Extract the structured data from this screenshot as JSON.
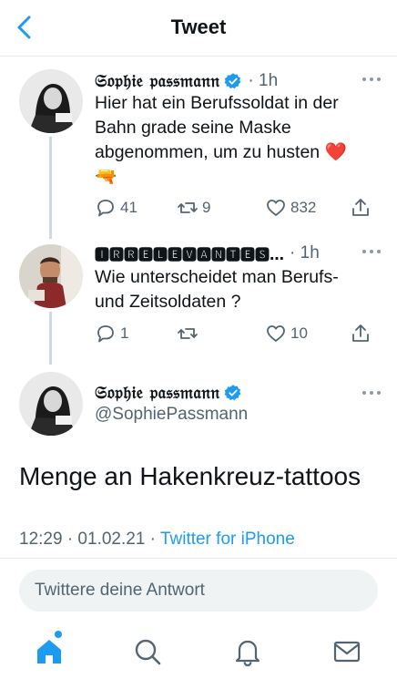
{
  "header": {
    "title": "Tweet"
  },
  "thread": [
    {
      "display_name": "𝔖𝔬𝔭𝔥𝔦𝔢 𝔭𝔞𝔰𝔰𝔪𝔞𝔫𝔫",
      "verified": true,
      "time": "· 1h",
      "text": "Hier hat ein Berufssoldat in der Bahn grade seine Maske abgenommen, um zu husten ❤️",
      "emoji_line": "🔫",
      "replies": "41",
      "retweets": "9",
      "likes": "832"
    },
    {
      "display_name": "🅸🆁🆁🅴🅻🅴🆅🅰🅽🆃🅴🆂…",
      "verified": false,
      "time": "· 1h",
      "text": "Wie unterscheidet man Berufs- und Zeitsoldaten ?",
      "replies": "1",
      "retweets": "",
      "likes": "10"
    }
  ],
  "main_tweet": {
    "display_name": "𝔖𝔬𝔭𝔥𝔦𝔢 𝔭𝔞𝔰𝔰𝔪𝔞𝔫𝔫",
    "verified": true,
    "handle": "@SophiePassmann",
    "text": "Menge an Hakenkreuz-tattoos",
    "timestamp": "12:29 · 01.02.21 · ",
    "source": "Twitter for iPhone"
  },
  "reply": {
    "placeholder": "Twittere deine Antwort"
  },
  "colors": {
    "accent": "#1d9bf0",
    "secondary_text": "#536471",
    "primary_text": "#0f1419",
    "like_red": "#e0245e"
  },
  "icons": [
    "back-arrow-icon",
    "verified-badge-icon",
    "more-dots-icon",
    "reply-icon",
    "retweet-icon",
    "like-heart-icon",
    "share-icon",
    "home-icon",
    "search-icon",
    "notifications-bell-icon",
    "messages-envelope-icon"
  ]
}
